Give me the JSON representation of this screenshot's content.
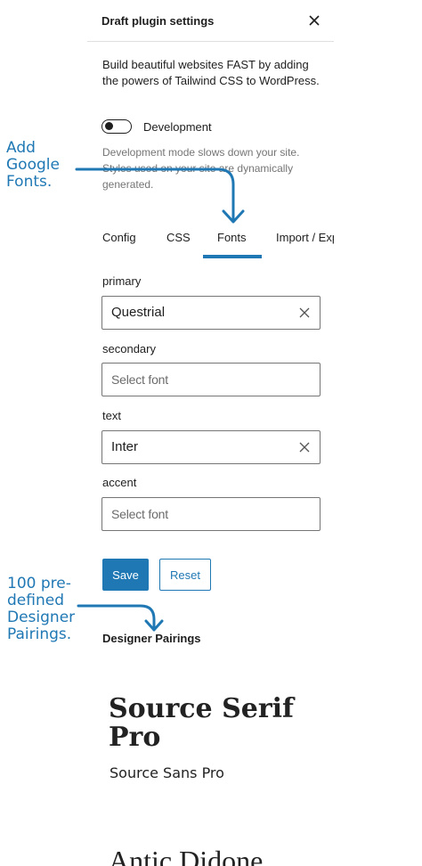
{
  "panel": {
    "title": "Draft plugin settings",
    "close_icon": "close-icon",
    "intro": "Build beautiful websites FAST by adding the powers of Tailwind CSS to WordPress.",
    "toggle_label": "Development",
    "toggle_on": false,
    "help": "Development mode slows down your site. Styles used on your site are dynamically generated."
  },
  "tabs": [
    {
      "label": "Config",
      "active": false
    },
    {
      "label": "CSS",
      "active": false
    },
    {
      "label": "Fonts",
      "active": true
    },
    {
      "label": "Import / Export",
      "active": false
    }
  ],
  "fonts": [
    {
      "label": "primary",
      "value": "Questrial",
      "placeholder": ""
    },
    {
      "label": "secondary",
      "value": "",
      "placeholder": "Select font"
    },
    {
      "label": "text",
      "value": "Inter",
      "placeholder": ""
    },
    {
      "label": "accent",
      "value": "",
      "placeholder": "Select font"
    }
  ],
  "buttons": {
    "save": "Save",
    "reset": "Reset"
  },
  "pairings": {
    "heading": "Designer Pairings",
    "items": [
      {
        "heading_font": "Source Serif Pro",
        "body_font": "Source Sans Pro"
      },
      {
        "heading_font": "Antic Didone",
        "body_font": ""
      }
    ]
  },
  "annotations": {
    "google_fonts": [
      "Add",
      "Google",
      "Fonts."
    ],
    "pairings": [
      "100 pre-",
      "defined",
      "Designer",
      "Pairings."
    ]
  },
  "colors": {
    "accent": "#1f78b4",
    "text": "#1e1e1e",
    "muted": "#757575"
  }
}
